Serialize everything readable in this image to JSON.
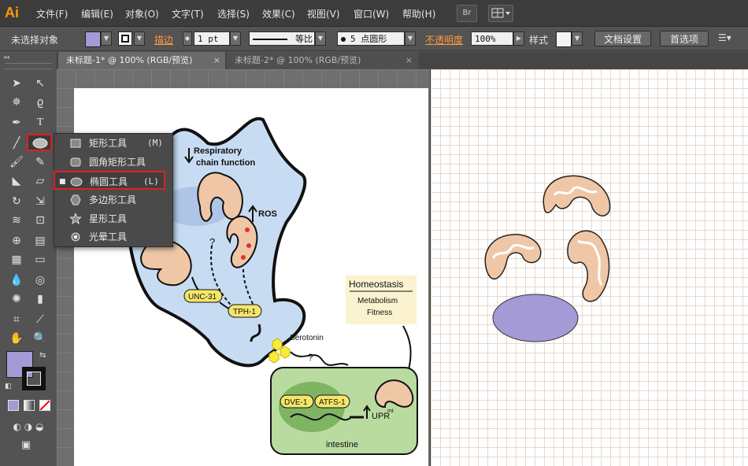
{
  "app": {
    "logo": "Ai"
  },
  "menu": [
    "文件(F)",
    "编辑(E)",
    "对象(O)",
    "文字(T)",
    "选择(S)",
    "效果(C)",
    "视图(V)",
    "窗口(W)",
    "帮助(H)"
  ],
  "menu_buttons": {
    "bridge": "Br"
  },
  "control": {
    "selection_status": "未选择对象",
    "stroke_label": "描边",
    "stroke_weight": "1 pt",
    "profile_label": "等比",
    "brush_value": "5 点圆形",
    "opacity_label": "不透明度",
    "opacity_value": "100%",
    "style_label": "样式",
    "doc_setup": "文档设置",
    "preferences": "首选项"
  },
  "tabs": [
    {
      "label": "未标题-1* @ 100% (RGB/预览)",
      "active": true
    },
    {
      "label": "未标题-2* @ 100% (RGB/预览)",
      "active": false
    }
  ],
  "flyout": {
    "items": [
      {
        "label": "矩形工具",
        "key": "(M)",
        "icon": "rectangle-icon"
      },
      {
        "label": "圆角矩形工具",
        "key": "",
        "icon": "rounded-rectangle-icon"
      },
      {
        "label": "椭圆工具",
        "key": "(L)",
        "icon": "ellipse-icon",
        "selected": true
      },
      {
        "label": "多边形工具",
        "key": "",
        "icon": "polygon-icon"
      },
      {
        "label": "星形工具",
        "key": "",
        "icon": "star-icon"
      },
      {
        "label": "光晕工具",
        "key": "",
        "icon": "flare-icon"
      }
    ]
  },
  "figure": {
    "respiratory": "Respiratory",
    "chain": "chain function",
    "ros": "ROS",
    "question1": "?",
    "question2": "?",
    "unc31": "UNC-31",
    "tph1": "TPH-1",
    "serotonin": "Serotonin",
    "homeostasis": "Homeostasis",
    "metabolism": "Metabolism",
    "fitness": "Fitness",
    "dve1": "DVE-1",
    "atfs1": "ATFS-1",
    "upr": "UPR",
    "upr_sup": "mt",
    "intestine": "intestine"
  },
  "colors": {
    "accent_orange": "#ff9a00",
    "fill_swatch": "#a49ad6",
    "highlight_red": "#e02020",
    "cell_blue": "#c7dcf2",
    "intestine_green": "#b9dba0",
    "mito_fill": "#efc7a7"
  }
}
